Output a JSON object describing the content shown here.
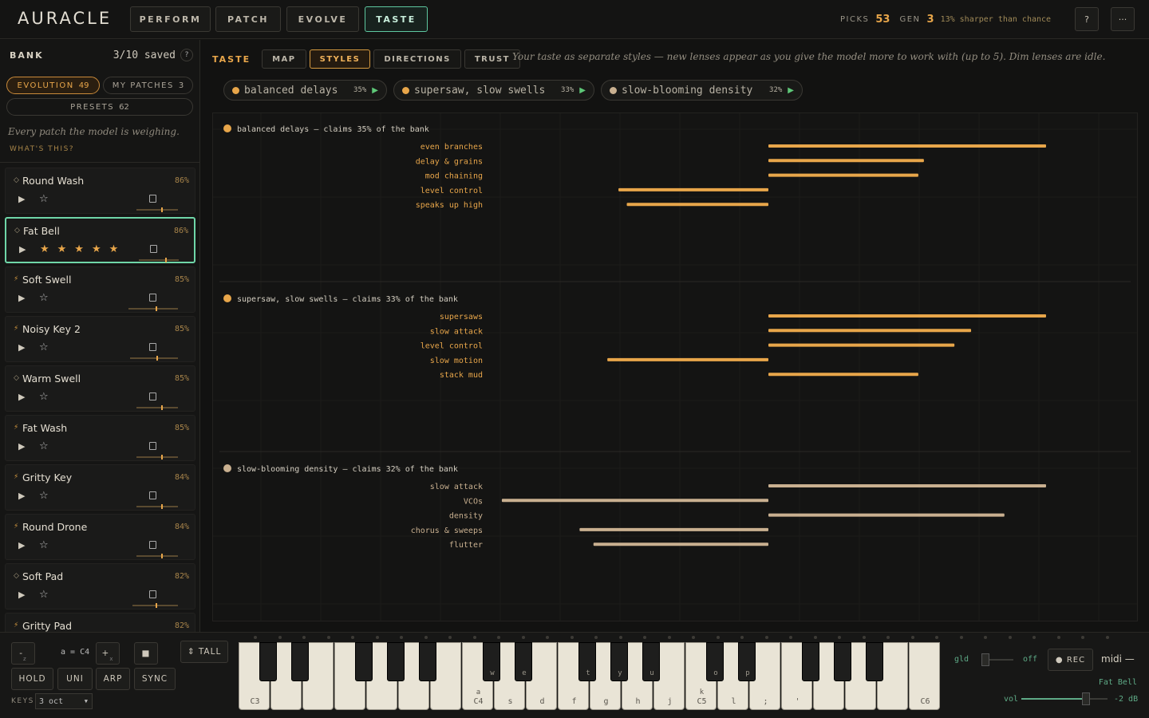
{
  "app": {
    "logo": "AURACLE"
  },
  "nav": {
    "tabs": [
      "PERFORM",
      "PATCH",
      "EVOLVE",
      "TASTE"
    ],
    "active": "TASTE"
  },
  "stats": {
    "picks_label": "PICKS",
    "picks": "53",
    "gen_label": "GEN",
    "gen": "3",
    "chance": "13% sharper than chance",
    "help": "?",
    "more": "···"
  },
  "bank": {
    "title": "BANK",
    "saved": "3/10 saved",
    "help": "?",
    "tabs": [
      {
        "label": "EVOLUTION",
        "count": "49"
      },
      {
        "label": "MY PATCHES",
        "count": "3"
      },
      {
        "label": "PRESETS",
        "count": "62"
      }
    ],
    "note": "Every patch the model is weighing.",
    "whats": "WHAT'S THIS?",
    "patches": [
      {
        "name": "Round Wash",
        "marker": "◇",
        "pct": "86%",
        "rating": 0,
        "slider": 0.6
      },
      {
        "name": "Fat Bell",
        "marker": "◇",
        "pct": "86%",
        "rating": 5,
        "slider": 0.65,
        "selected": true
      },
      {
        "name": "Soft Swell",
        "marker": "⚡",
        "pct": "85%",
        "rating": 0,
        "slider": 0.55
      },
      {
        "name": "Noisy Key 2",
        "marker": "⚡",
        "pct": "85%",
        "rating": 0,
        "slider": 0.55
      },
      {
        "name": "Warm Swell",
        "marker": "◇",
        "pct": "85%",
        "rating": 0,
        "slider": 0.6
      },
      {
        "name": "Fat Wash",
        "marker": "⚡",
        "pct": "85%",
        "rating": 0,
        "slider": 0.6
      },
      {
        "name": "Gritty Key",
        "marker": "⚡",
        "pct": "84%",
        "rating": 0,
        "slider": 0.6
      },
      {
        "name": "Round Drone",
        "marker": "⚡",
        "pct": "84%",
        "rating": 0,
        "slider": 0.6
      },
      {
        "name": "Soft Pad",
        "marker": "◇",
        "pct": "82%",
        "rating": 0,
        "slider": 0.5
      },
      {
        "name": "Gritty Pad",
        "marker": "⚡",
        "pct": "82%",
        "rating": 0,
        "slider": 0.5
      }
    ]
  },
  "taste": {
    "label": "TASTE",
    "subtabs": [
      "MAP",
      "STYLES",
      "DIRECTIONS",
      "TRUST"
    ],
    "active": "STYLES",
    "description": "Your taste as separate styles — new lenses appear as you give the model more to work with (up to 5). Dim lenses are idle.",
    "lenses": [
      {
        "name": "balanced delays",
        "pct": "35%",
        "color": "#e8a64a"
      },
      {
        "name": "supersaw, slow swells",
        "pct": "33%",
        "color": "#e8a64a"
      },
      {
        "name": "slow-blooming density",
        "pct": "32%",
        "color": "#c9b090"
      }
    ],
    "play_icon": "▶"
  },
  "chart_data": {
    "type": "bar",
    "orientation": "horizontal",
    "panels": [
      {
        "title": "balanced delays — claims 35% of the bank",
        "color": "#e8a64a",
        "categories": [
          "even branches",
          "delay & grains",
          "mod chaining",
          "level control",
          "speaks up high"
        ],
        "values": [
          1.0,
          0.56,
          0.54,
          -0.54,
          -0.51
        ]
      },
      {
        "title": "supersaw, slow swells — claims 33% of the bank",
        "color": "#e8a64a",
        "categories": [
          "supersaws",
          "slow attack",
          "level control",
          "slow motion",
          "stack mud"
        ],
        "values": [
          1.0,
          0.73,
          0.67,
          -0.58,
          0.54
        ]
      },
      {
        "title": "slow-blooming density — claims 32% of the bank",
        "color": "#c9b090",
        "categories": [
          "slow attack",
          "VCOs",
          "density",
          "chorus & sweeps",
          "flutter"
        ],
        "values": [
          1.0,
          -0.96,
          0.85,
          -0.68,
          -0.63
        ]
      }
    ]
  },
  "keyboard": {
    "oct_down": "-",
    "oct_down_key": "z",
    "octave": "a = C4",
    "oct_up": "+",
    "oct_up_key": "x",
    "stop": "■",
    "tall": "⇕ TALL",
    "buttons": [
      "HOLD",
      "UNI",
      "ARP",
      "SYNC"
    ],
    "keys_label": "KEYS",
    "keys_value": "3 oct",
    "white_labels": [
      {
        "n": "C3",
        "k": ""
      },
      {
        "n": "",
        "k": ""
      },
      {
        "n": "",
        "k": ""
      },
      {
        "n": "",
        "k": ""
      },
      {
        "n": "",
        "k": ""
      },
      {
        "n": "",
        "k": ""
      },
      {
        "n": "",
        "k": ""
      },
      {
        "n": "C4",
        "k": "a"
      },
      {
        "n": "s",
        "k": ""
      },
      {
        "n": "d",
        "k": ""
      },
      {
        "n": "f",
        "k": ""
      },
      {
        "n": "g",
        "k": ""
      },
      {
        "n": "h",
        "k": ""
      },
      {
        "n": "j",
        "k": ""
      },
      {
        "n": "C5",
        "k": "k"
      },
      {
        "n": "l",
        "k": ""
      },
      {
        "n": ";",
        "k": ""
      },
      {
        "n": "'",
        "k": ""
      },
      {
        "n": "",
        "k": ""
      },
      {
        "n": "",
        "k": ""
      },
      {
        "n": "",
        "k": ""
      },
      {
        "n": "C6",
        "k": ""
      }
    ],
    "black_labels": [
      "",
      "",
      "",
      "",
      "",
      "w",
      "e",
      "t",
      "y",
      "u",
      "o",
      "p",
      "",
      "",
      "",
      ""
    ],
    "glide_label": "gld",
    "glide_value": "off",
    "rec": "● REC",
    "midi": "midi —",
    "patch": "Fat Bell",
    "vol_label": "vol",
    "vol_value": "-2 dB",
    "glide": 0.05,
    "volume": 0.75
  }
}
